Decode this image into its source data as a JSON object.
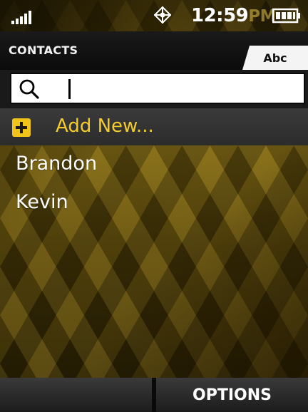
{
  "status_bar": {
    "signal_icon": "signal-bars-icon",
    "gps_icon": "gps-target-icon",
    "time": "12:59",
    "ampm": "PM",
    "battery_icon": "battery-full-icon"
  },
  "header": {
    "title": "CONTACTS",
    "tab_label": "Abc"
  },
  "search": {
    "icon": "search-icon",
    "value": "",
    "placeholder": ""
  },
  "add_new": {
    "icon": "plus-icon",
    "label": "Add New..."
  },
  "contacts": [
    {
      "name": "Brandon"
    },
    {
      "name": "Kevin"
    }
  ],
  "softkeys": {
    "left_label": "",
    "right_label": "OPTIONS"
  },
  "colors": {
    "accent": "#f3cc2b",
    "background": "#5a4a0a"
  }
}
